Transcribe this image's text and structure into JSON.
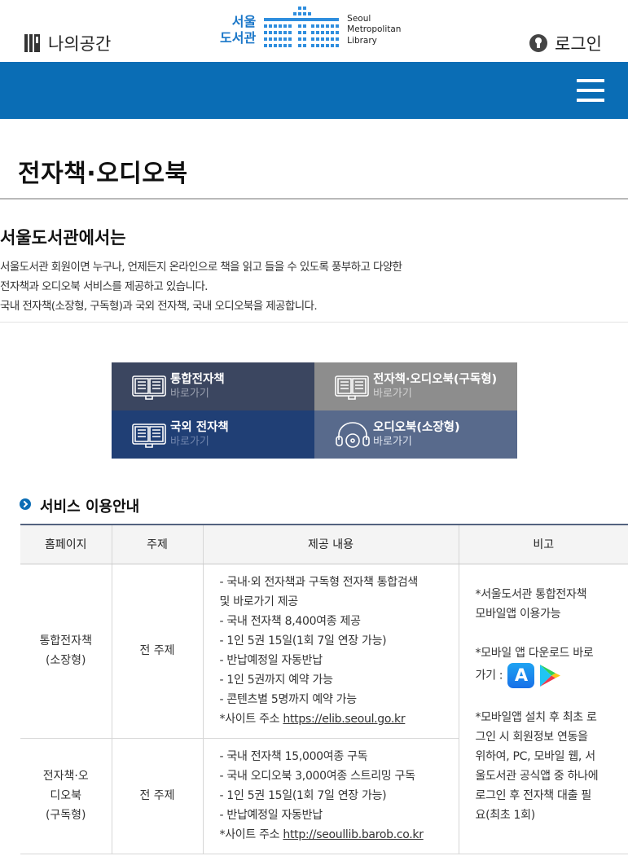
{
  "header": {
    "my_space": "나의공간",
    "logo_ko": [
      "서울",
      "도서관"
    ],
    "logo_en": [
      "Seoul",
      "Metropolitan",
      "Library"
    ],
    "login": "로그인"
  },
  "page_title": "전자책·오디오북",
  "intro": {
    "heading": "서울도서관에서는",
    "lines": [
      "서울도서관 회원이면 누구나, 언제든지 온라인으로 책을 읽고 들을 수 있도록 풍부하고 다양한",
      "전자책과 오디오북 서비스를 제공하고 있습니다.",
      "국내 전자책(소장형, 구독형)과 국외 전자책, 국내 오디오북을 제공합니다."
    ]
  },
  "tiles": [
    {
      "title": "통합전자책",
      "sub": "바로가기",
      "icon": "ebook-reader-icon"
    },
    {
      "title": "전자책·오디오북(구독형)",
      "sub": "바로가기",
      "icon": "ebook-reader-icon"
    },
    {
      "title": "국외 전자책",
      "sub": "바로가기",
      "icon": "ebook-reader-icon"
    },
    {
      "title": "오디오북(소장형)",
      "sub": "바로가기",
      "icon": "headphones-icon"
    }
  ],
  "section_title": "서비스 이용안내",
  "table": {
    "headers": [
      "홈페이지",
      "주제",
      "제공 내용",
      "비고"
    ],
    "rows": [
      {
        "homepage": [
          "통합전자책",
          "(소장형)"
        ],
        "subject": "전 주제",
        "content": [
          "- 국내·외 전자책과 구독형 전자책 통합검색",
          "및 바로가기 제공",
          "- 국내 전자책 8,400여종 제공",
          "- 1인 5권 15일(1회 7일 연장 가능)",
          "- 반납예정일 자동반납",
          "- 1인 5권까지 예약 가능",
          "- 콘텐츠별 5명까지 예약 가능"
        ],
        "site_label": "*사이트 주소 ",
        "site_url": "https://elib.seoul.go.kr"
      },
      {
        "homepage": [
          "전자책·오",
          "디오북",
          "(구독형)"
        ],
        "subject": "전 주제",
        "content": [
          "- 국내 전자책 15,000여종 구독",
          "- 국내 오디오북 3,000여종 스트리밍 구독",
          "- 1인 5권 15일(1회 7일 연장 가능)",
          "- 반납예정일 자동반납"
        ],
        "site_label": "*사이트 주소 ",
        "site_url": "http://seoullib.barob.co.kr"
      }
    ],
    "note": {
      "p1": [
        "*서울도서관 통합전자책",
        "모바일앱 이용가능"
      ],
      "p2": [
        "*모바일 앱 다운로드 바로",
        "가기 : "
      ],
      "p3": [
        "*모바일앱 설치 후 최초 로",
        "그인 시 회원정보 연동을",
        "위하여, PC, 모바일 웹, 서",
        "울도서관 공식앱 중 하나에",
        "로그인 후 전자책 대출 필",
        "요(최초 1회)"
      ]
    }
  }
}
